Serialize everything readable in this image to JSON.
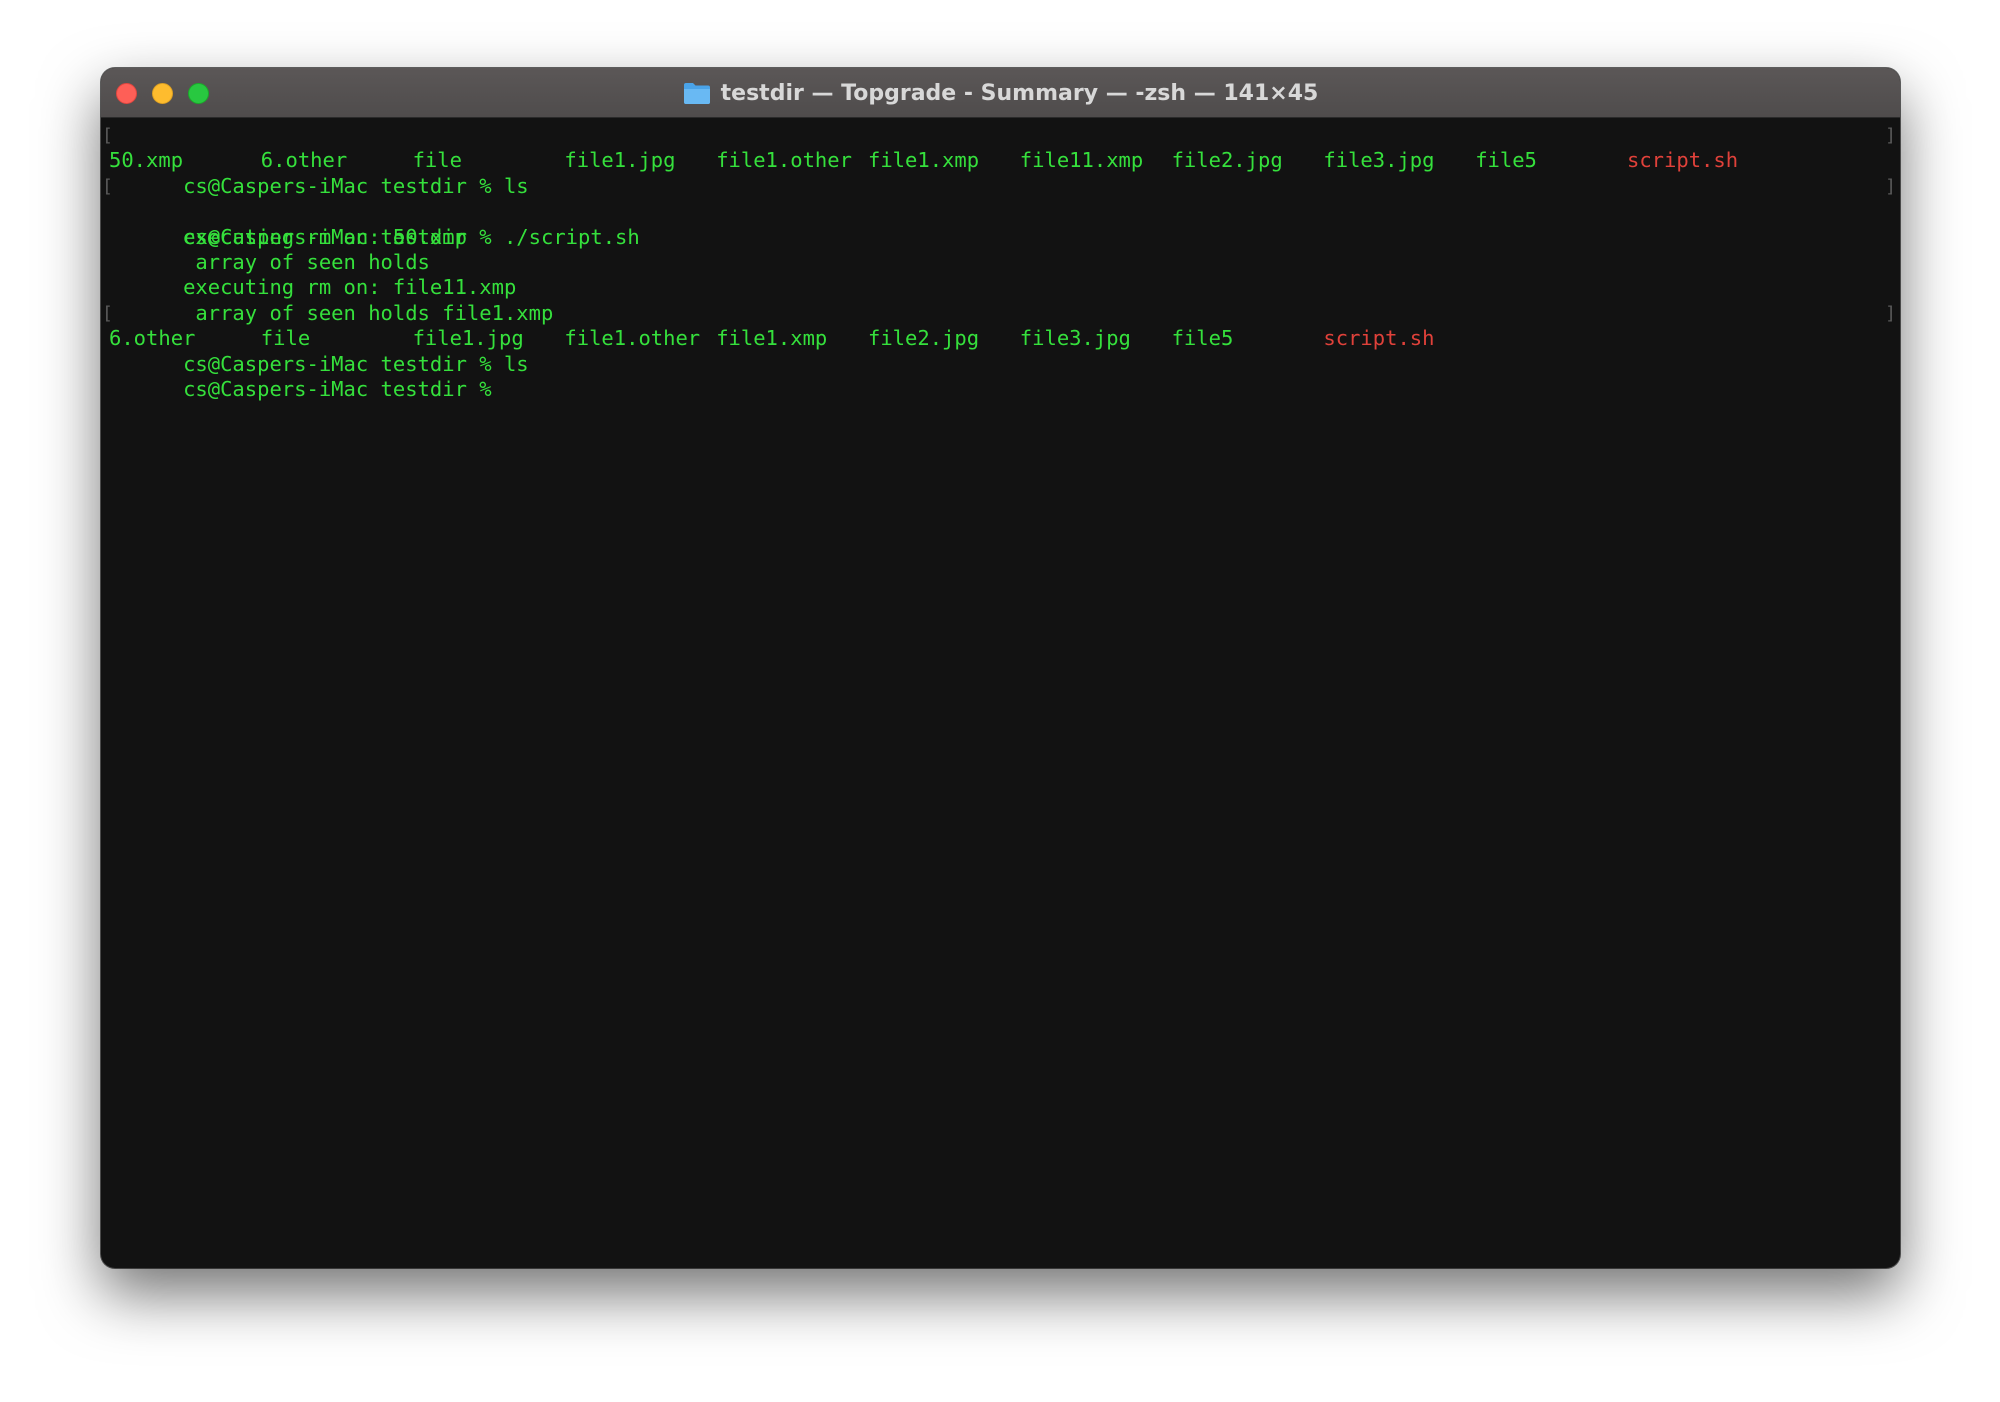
{
  "window": {
    "title": "testdir — Topgrade - Summary — -zsh — 141×45",
    "accent_colors": {
      "close": "#fe5f57",
      "minimize": "#febc2e",
      "zoom": "#28c840"
    },
    "folder_icon": "folder-icon"
  },
  "terminal": {
    "text_color": "#35e03c",
    "highlight_color": "#e0413a",
    "prompt1": "cs@Caspers-iMac testdir % ls",
    "ls1": [
      "50.xmp",
      "6.other",
      "file",
      "file1.jpg",
      "file1.other",
      "file1.xmp",
      "file11.xmp",
      "file2.jpg",
      "file3.jpg",
      "file5",
      "script.sh"
    ],
    "prompt2": "cs@Caspers-iMac testdir % ./script.sh",
    "out1": "executing rm on: 50.xmp",
    "out2": " array of seen holds",
    "out3": "executing rm on: file11.xmp",
    "out4": " array of seen holds file1.xmp",
    "prompt3": "cs@Caspers-iMac testdir % ls",
    "ls2": [
      "6.other",
      "file",
      "file1.jpg",
      "file1.other",
      "file1.xmp",
      "file2.jpg",
      "file3.jpg",
      "file5",
      "script.sh"
    ],
    "prompt4": "cs@Caspers-iMac testdir %"
  }
}
